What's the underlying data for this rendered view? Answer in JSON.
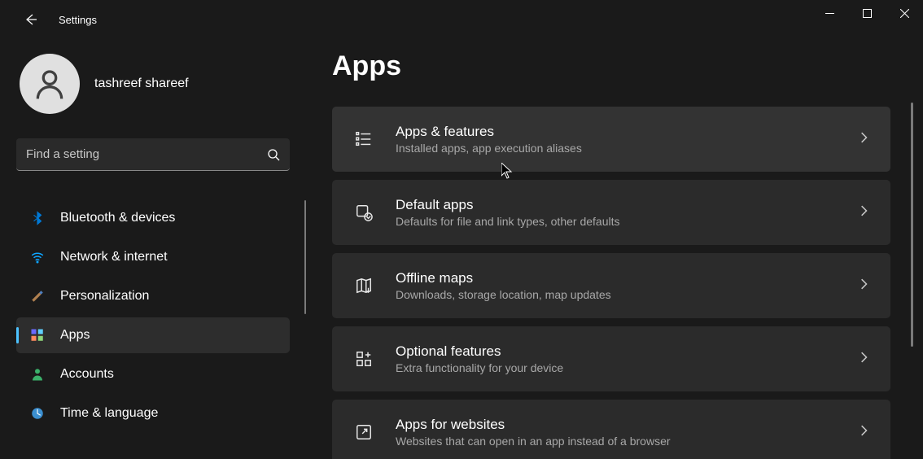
{
  "header": {
    "title": "Settings"
  },
  "user": {
    "name": "tashreef shareef"
  },
  "search": {
    "placeholder": "Find a setting"
  },
  "sidebar": {
    "items": [
      {
        "label": "Bluetooth & devices"
      },
      {
        "label": "Network & internet"
      },
      {
        "label": "Personalization"
      },
      {
        "label": "Apps"
      },
      {
        "label": "Accounts"
      },
      {
        "label": "Time & language"
      }
    ]
  },
  "page": {
    "title": "Apps"
  },
  "cards": [
    {
      "title": "Apps & features",
      "sub": "Installed apps, app execution aliases"
    },
    {
      "title": "Default apps",
      "sub": "Defaults for file and link types, other defaults"
    },
    {
      "title": "Offline maps",
      "sub": "Downloads, storage location, map updates"
    },
    {
      "title": "Optional features",
      "sub": "Extra functionality for your device"
    },
    {
      "title": "Apps for websites",
      "sub": "Websites that can open in an app instead of a browser"
    }
  ]
}
